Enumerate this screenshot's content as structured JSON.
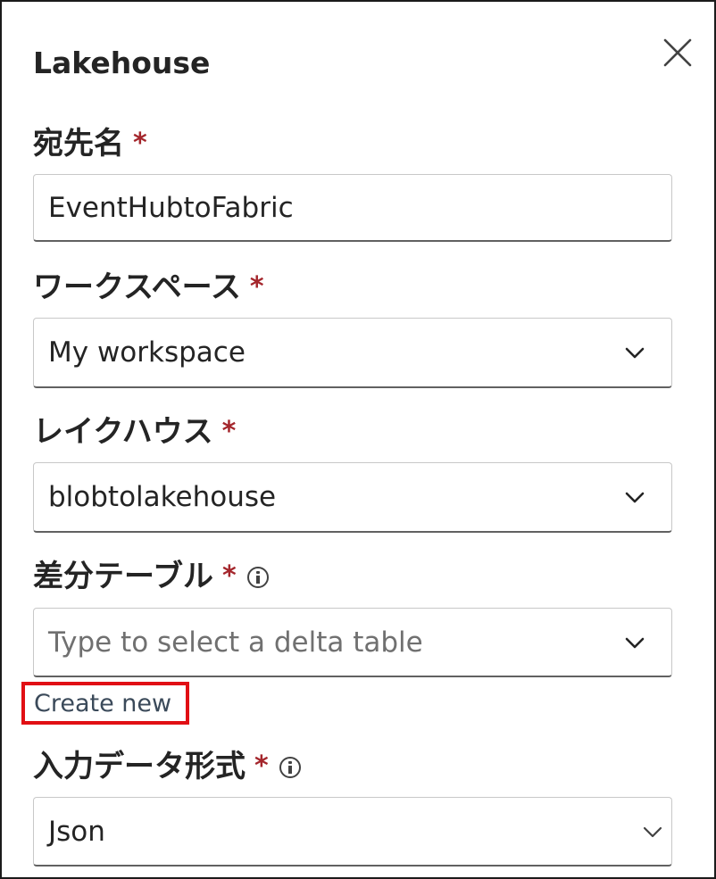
{
  "panel": {
    "title": "Lakehouse",
    "close_icon": "close-icon"
  },
  "fields": {
    "destination_name": {
      "label": "宛先名",
      "required_mark": "*",
      "value": "EventHubtoFabric"
    },
    "workspace": {
      "label": "ワークスペース",
      "required_mark": "*",
      "value": "My workspace",
      "icon": "chevron-down-icon"
    },
    "lakehouse": {
      "label": "レイクハウス",
      "required_mark": "*",
      "value": "blobtolakehouse",
      "icon": "chevron-down-icon"
    },
    "delta_table": {
      "label": "差分テーブル",
      "required_mark": "*",
      "placeholder": "Type to select a delta table",
      "icon": "chevron-down-icon",
      "info_icon": "info-icon"
    },
    "create_new": "Create new",
    "input_format": {
      "label": "入力データ形式",
      "required_mark": "*",
      "value": "Json",
      "icon": "chevron-down-icon",
      "info_icon": "info-icon"
    }
  },
  "colors": {
    "required": "#a4262c",
    "highlight_box": "#e10f14",
    "link": "#3b4a5a"
  }
}
